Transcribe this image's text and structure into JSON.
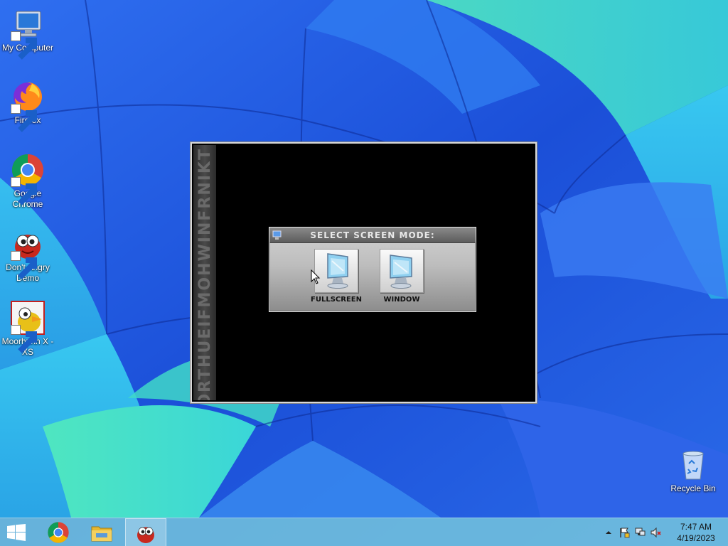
{
  "desktop": {
    "icons": [
      {
        "label": "My Computer"
      },
      {
        "label": "Firefox"
      },
      {
        "label": "Google Chrome"
      },
      {
        "label": "Don't Angry Demo"
      },
      {
        "label": "Moorhuhn X - XS"
      },
      {
        "label": "Recycle Bin"
      }
    ]
  },
  "app_window": {
    "side_text": "MORTHUEIFMOHWINFRNIKT",
    "dialog": {
      "title": "SELECT SCREEN MODE:",
      "fullscreen_label": "FULLSCREEN",
      "window_label": "WINDOW"
    }
  },
  "taskbar": {
    "clock_time": "7:47 AM",
    "clock_date": "4/19/2023"
  },
  "colors": {
    "wallpaper_blue": "#1f5fe0",
    "wallpaper_cyan": "#3ad0e8",
    "wallpaper_green": "#45e0b0",
    "taskbar": "#78c8dc"
  }
}
